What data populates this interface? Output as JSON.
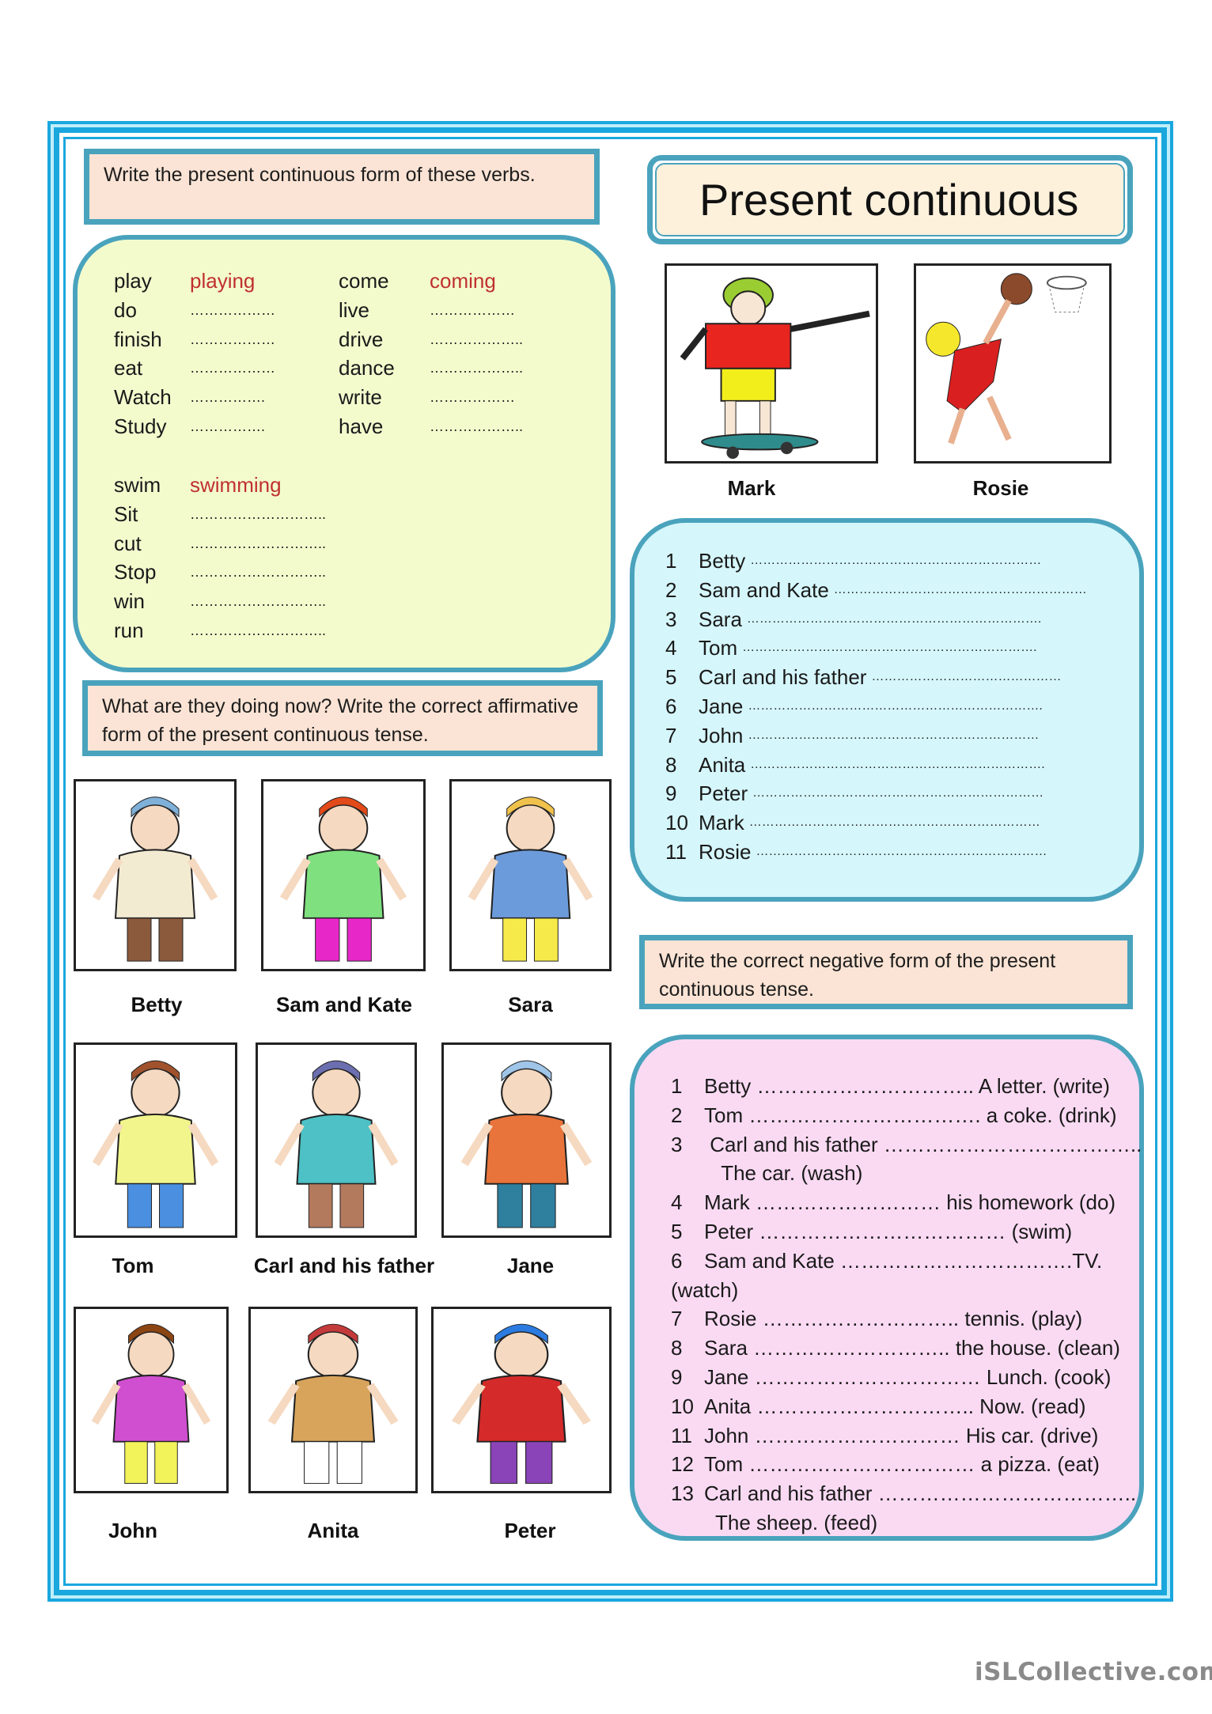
{
  "title": "Present continuous",
  "section1": {
    "instruction": "Write the present continuous form of these verbs.",
    "verbs_left": [
      {
        "verb": "play",
        "answer": "playing"
      },
      {
        "verb": "do",
        "answer": "………………"
      },
      {
        "verb": "finish",
        "answer": "………………"
      },
      {
        "verb": "eat",
        "answer": "………………"
      },
      {
        "verb": "Watch",
        "answer": "……………."
      },
      {
        "verb": "Study",
        "answer": "……………."
      }
    ],
    "verbs_right": [
      {
        "verb": "come",
        "answer": "coming"
      },
      {
        "verb": "live",
        "answer": "………………"
      },
      {
        "verb": "drive",
        "answer": "……………….."
      },
      {
        "verb": "dance",
        "answer": "……………….."
      },
      {
        "verb": "write",
        "answer": "………………"
      },
      {
        "verb": "have",
        "answer": "……………….."
      }
    ],
    "verbs_double": [
      {
        "verb": "swim",
        "answer": "swimming"
      },
      {
        "verb": "Sit",
        "answer": "……………………….."
      },
      {
        "verb": "cut",
        "answer": "……………………….."
      },
      {
        "verb": "Stop",
        "answer": "……………………….."
      },
      {
        "verb": "win",
        "answer": "……………………….."
      },
      {
        "verb": "run",
        "answer": "……………………….."
      }
    ]
  },
  "section2": {
    "instruction": "What are they doing now? Write the correct affirmative form of the present continuous tense.",
    "pictures": [
      {
        "name": "Betty",
        "icon": "woman-reading-newspaper-illustration"
      },
      {
        "name": "Sam and Kate",
        "icon": "kids-dancing-illustration"
      },
      {
        "name": "Sara",
        "icon": "girl-feeding-chickens-illustration"
      },
      {
        "name": "Tom",
        "icon": "boy-eating-illustration"
      },
      {
        "name": "Carl and his father",
        "icon": "father-son-fishing-illustration"
      },
      {
        "name": "Jane",
        "icon": "girl-ironing-illustration"
      },
      {
        "name": "John",
        "icon": "man-taking-photo-illustration"
      },
      {
        "name": "Anita",
        "icon": "woman-listening-music-illustration"
      },
      {
        "name": "Peter",
        "icon": "boy-riding-bike-illustration"
      }
    ],
    "top_pictures": [
      {
        "name": "Mark",
        "icon": "boy-skateboarding-illustration"
      },
      {
        "name": "Rosie",
        "icon": "girl-playing-basketball-illustration"
      }
    ],
    "answers": [
      {
        "num": "1",
        "name": "Betty",
        "dots": "……………………………………………………………"
      },
      {
        "num": "2",
        "name": "Sam and Kate",
        "dots": "……………………………………………………"
      },
      {
        "num": "3",
        "name": "Sara",
        "dots": "……………………………………………………………."
      },
      {
        "num": "4",
        "name": "Tom",
        "dots": "……………………………………………………………."
      },
      {
        "num": "5",
        "name": "Carl and his father",
        "dots": "………………………………………"
      },
      {
        "num": "6",
        "name": "Jane",
        "dots": "……………………………………………………………."
      },
      {
        "num": "7",
        "name": "John",
        "dots": "……………………………………………………………"
      },
      {
        "num": "8",
        "name": "Anita",
        "dots": "……………………………………………………………."
      },
      {
        "num": "9",
        "name": "Peter",
        "dots": "……………………………………………………………"
      },
      {
        "num": "10",
        "name": "Mark",
        "dots": "……………………………………………………………"
      },
      {
        "num": "11",
        "name": "Rosie",
        "dots": "……………………………………………………………"
      }
    ]
  },
  "section3": {
    "instruction": "Write the correct negative form of the present continuous tense.",
    "items": [
      {
        "num": "1",
        "text": "Betty ………………………….. A letter. (write)"
      },
      {
        "num": "2",
        "text": "Tom ……………………………. a coke. (drink)"
      },
      {
        "num": "3",
        "text": " Carl and his father ……………………………….."
      },
      {
        "num": "",
        "text": "   The car. (wash)"
      },
      {
        "num": "4",
        "text": "Mark ……………………… his homework (do)"
      },
      {
        "num": "5",
        "text": "Peter ……………………………… (swim)"
      },
      {
        "num": "6",
        "text": "Sam and Kate …………………………….TV."
      },
      {
        "num": "",
        "text": "(watch)",
        "outdent": true
      },
      {
        "num": "7",
        "text": "Rosie ……………………….. tennis. (play)"
      },
      {
        "num": "8",
        "text": "Sara ……………………….. the house. (clean)"
      },
      {
        "num": "9",
        "text": "Jane …………………………… Lunch. (cook)"
      },
      {
        "num": "10",
        "text": "Anita ………………………….. Now. (read)"
      },
      {
        "num": "11",
        "text": "John ………………………… His car. (drive)"
      },
      {
        "num": "12",
        "text": "Tom …………………………… a pizza. (eat)"
      },
      {
        "num": "13",
        "text": "Carl and his father ……………………………….."
      },
      {
        "num": "",
        "text": "  The sheep. (feed)"
      }
    ]
  },
  "watermark": "iSLCollective.com",
  "colors": {
    "border": "#1aa7de",
    "box_border": "#4aa3bd",
    "instr_bg": "#fbe4d5",
    "verbs_bg": "#f3fbcd",
    "answers_bg": "#d5f6fb",
    "negative_bg": "#fadaf3",
    "answer_red": "#c0302f"
  }
}
